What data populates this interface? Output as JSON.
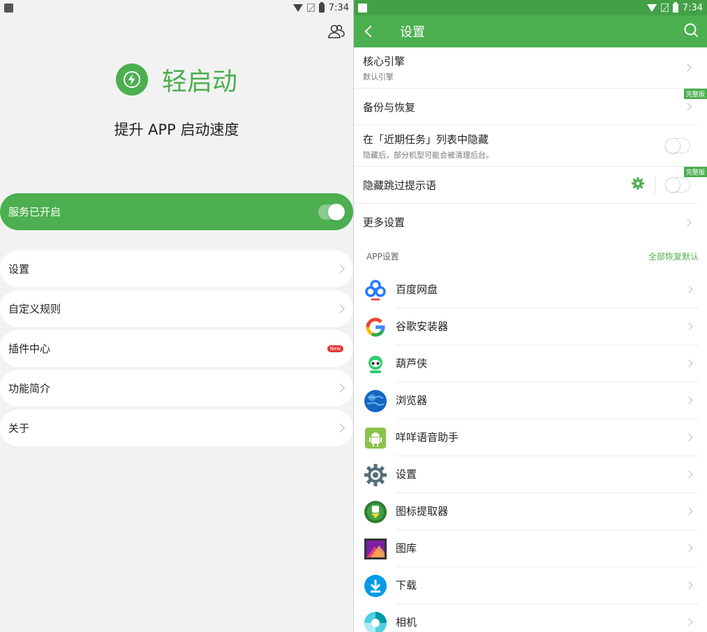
{
  "left": {
    "status_bar": {
      "time": "7:34"
    },
    "app_name": "轻启动",
    "slogan": "提升 APP 启动速度",
    "service": {
      "label": "服务已开启",
      "enabled": true
    },
    "menu": [
      {
        "label": "设置"
      },
      {
        "label": "自定义规则"
      },
      {
        "label": "插件中心",
        "badge": "New"
      },
      {
        "label": "功能简介"
      },
      {
        "label": "关于"
      }
    ]
  },
  "right": {
    "status_bar": {
      "time": "7:34"
    },
    "appbar": {
      "title": "设置"
    },
    "settings": [
      {
        "title": "核心引擎",
        "subtitle": "默认引擎"
      },
      {
        "title": "备份与恢复",
        "badge": "完整版"
      },
      {
        "title": "在「近期任务」列表中隐藏",
        "subtitle": "隐藏后，部分机型可能会被清理后台。"
      },
      {
        "title": "隐藏跳过提示语",
        "badge": "完整版"
      },
      {
        "title": "更多设置"
      }
    ],
    "app_section": {
      "title": "APP设置",
      "action": "全部恢复默认"
    },
    "apps": [
      {
        "name": "百度网盘",
        "icon": "baidu-netdisk-icon"
      },
      {
        "name": "谷歌安装器",
        "icon": "google-installer-icon"
      },
      {
        "name": "葫芦侠",
        "icon": "huluxia-icon"
      },
      {
        "name": "浏览器",
        "icon": "browser-globe-icon"
      },
      {
        "name": "咩咩语音助手",
        "icon": "android-icon"
      },
      {
        "name": "设置",
        "icon": "settings-gear-icon"
      },
      {
        "name": "图标提取器",
        "icon": "icon-extractor-icon"
      },
      {
        "name": "图库",
        "icon": "gallery-icon"
      },
      {
        "name": "下载",
        "icon": "download-icon"
      },
      {
        "name": "相机",
        "icon": "camera-icon"
      }
    ]
  },
  "colors": {
    "accent": "#4caf50",
    "status_bar_green": "#43a047",
    "badge_red": "#e53935"
  }
}
